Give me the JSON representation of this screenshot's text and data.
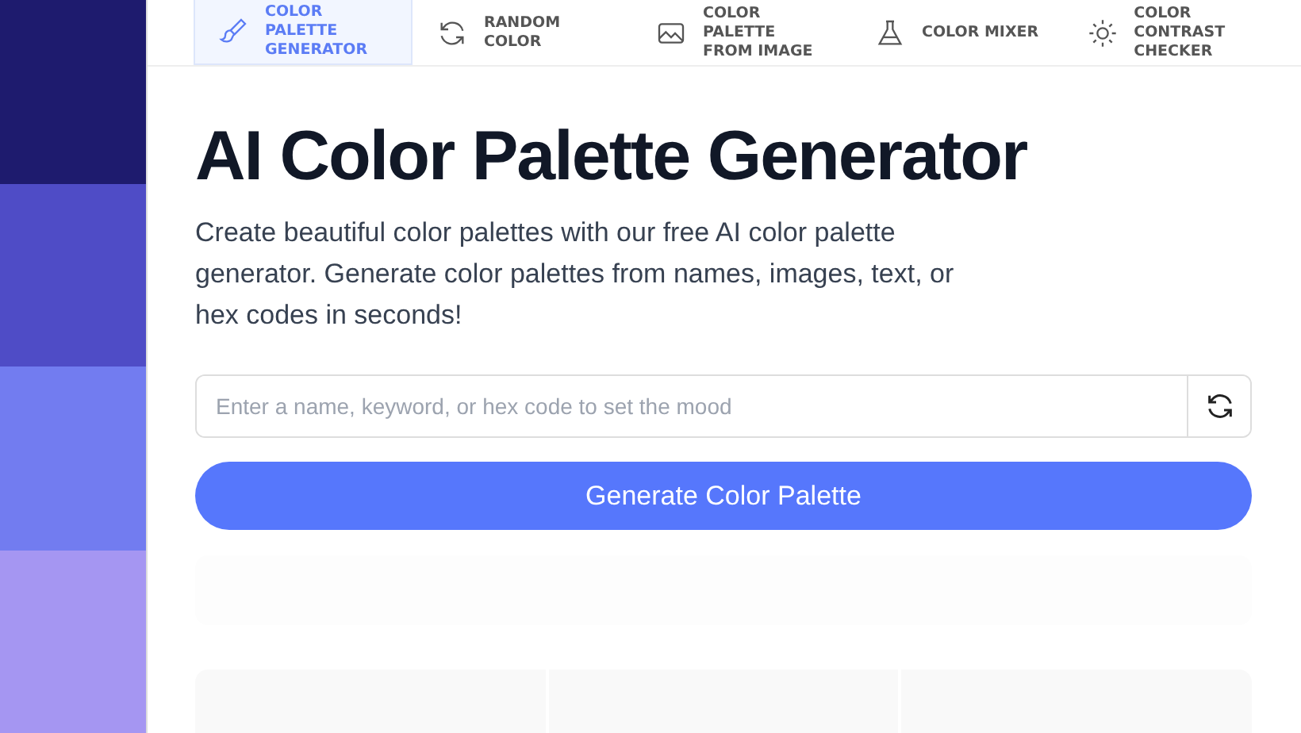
{
  "swatches": [
    {
      "color": "#1e1b6e"
    },
    {
      "color": "#4f4cc6"
    },
    {
      "color": "#727cf0"
    },
    {
      "color": "#a596f2"
    }
  ],
  "nav": [
    {
      "label": "COLOR PALETTE GENERATOR",
      "selected": true
    },
    {
      "label": "RANDOM COLOR",
      "selected": false
    },
    {
      "label": "COLOR PALETTE FROM IMAGE",
      "selected": false
    },
    {
      "label": "COLOR MIXER",
      "selected": false
    },
    {
      "label": "COLOR CONTRAST CHECKER",
      "selected": false
    }
  ],
  "title": "AI Color Palette Generator",
  "description": "Create beautiful color palettes with our free AI color palette generator. Generate color palettes from names, images, text, or hex codes in seconds!",
  "search": {
    "placeholder": "Enter a name, keyword, or hex code to set the mood"
  },
  "generate_button": "Generate Color Palette"
}
